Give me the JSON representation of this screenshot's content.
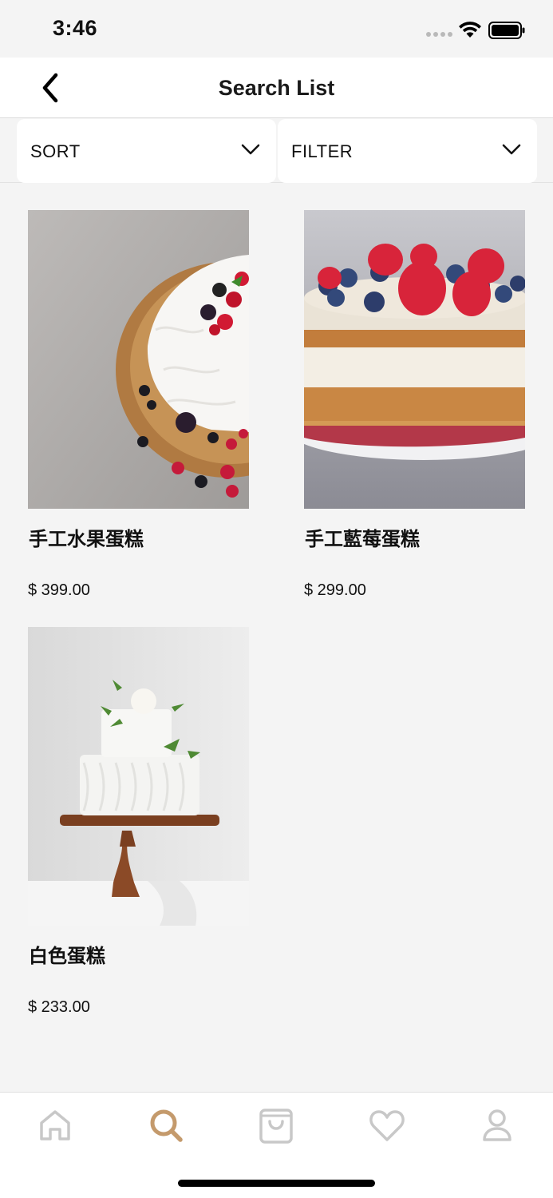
{
  "status_bar": {
    "time": "3:46"
  },
  "nav": {
    "title": "Search List"
  },
  "controls": {
    "sort_label": "SORT",
    "filter_label": "FILTER"
  },
  "products": [
    {
      "name": "手工水果蛋糕",
      "price": "$ 399.00"
    },
    {
      "name": "手工藍莓蛋糕",
      "price": "$ 299.00"
    },
    {
      "name": "白色蛋糕",
      "price": "$ 233.00"
    }
  ],
  "tab_bar": {
    "tabs": [
      {
        "icon": "home-icon",
        "active": false
      },
      {
        "icon": "search-icon",
        "active": true
      },
      {
        "icon": "bag-icon",
        "active": false
      },
      {
        "icon": "heart-icon",
        "active": false
      },
      {
        "icon": "profile-icon",
        "active": false
      }
    ],
    "active_color": "#c49a6c",
    "inactive_color": "#c8c8c8"
  }
}
